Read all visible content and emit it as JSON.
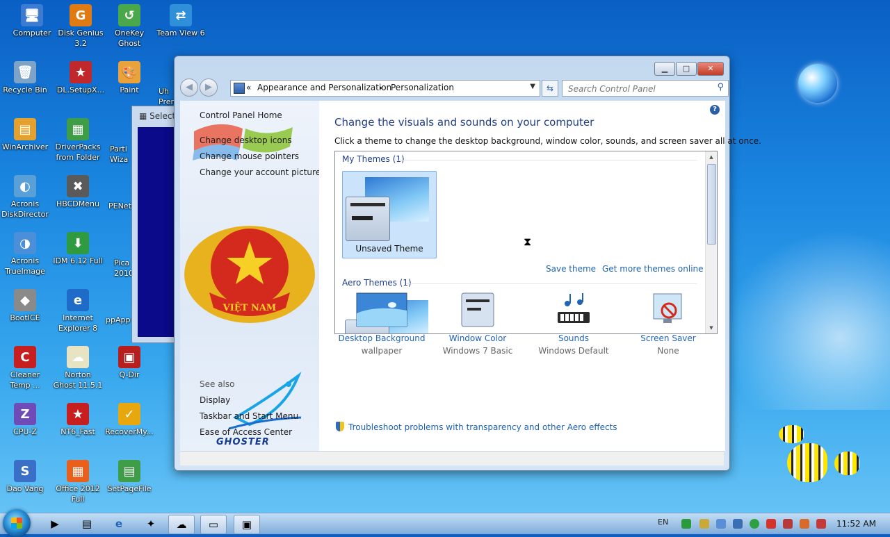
{
  "desktop": {
    "icons": [
      {
        "label": "Computer",
        "icon": "computer-icon",
        "glyph": "🖥"
      },
      {
        "label": "Disk Genius 3.2",
        "icon": "disk-genius-icon",
        "glyph": "G"
      },
      {
        "label": "OneKey Ghost",
        "icon": "onekey-ghost-icon",
        "glyph": "↺"
      },
      {
        "label": "Team View 6",
        "icon": "teamviewer-icon",
        "glyph": "⇄"
      },
      {
        "label": "Recycle Bin",
        "icon": "recycle-bin-icon",
        "glyph": "🗑"
      },
      {
        "label": "DL.SetupX...",
        "icon": "setup-icon",
        "glyph": "★"
      },
      {
        "label": "Paint",
        "icon": "paint-icon",
        "glyph": "🎨"
      },
      {
        "label": "WinArchiver",
        "icon": "winarchiver-icon",
        "glyph": "▤"
      },
      {
        "label": "DriverPacks from Folder",
        "icon": "driverpacks-icon",
        "glyph": "▦"
      },
      {
        "label": "Acronis DiskDirector",
        "icon": "acronis-diskdirector-icon",
        "glyph": "◐"
      },
      {
        "label": "HBCDMenu",
        "icon": "hbcdmenu-icon",
        "glyph": "✖"
      },
      {
        "label": "Acronis TrueImage",
        "icon": "acronis-trueimage-icon",
        "glyph": "◑"
      },
      {
        "label": "IDM 6.12 Full",
        "icon": "idm-icon",
        "glyph": "⬇"
      },
      {
        "label": "BootICE",
        "icon": "bootice-icon",
        "glyph": "◆"
      },
      {
        "label": "Internet Explorer 8",
        "icon": "internet-explorer-icon",
        "glyph": "e"
      },
      {
        "label": "Cleaner Temp ...",
        "icon": "cleaner-icon",
        "glyph": "C"
      },
      {
        "label": "Norton Ghost 11.5.1",
        "icon": "norton-ghost-icon",
        "glyph": "☁"
      },
      {
        "label": "Q-Dir",
        "icon": "qdir-icon",
        "glyph": "▣"
      },
      {
        "label": "CPU-Z",
        "icon": "cpuz-icon",
        "glyph": "Z"
      },
      {
        "label": "NT6_Fast",
        "icon": "nt6-fast-icon",
        "glyph": "★"
      },
      {
        "label": "RecoverMy...",
        "icon": "recovermy-icon",
        "glyph": "✓"
      },
      {
        "label": "Dao Vang",
        "icon": "dao-vang-icon",
        "glyph": "S"
      },
      {
        "label": "Office 2012 Full",
        "icon": "office-icon",
        "glyph": "▦"
      },
      {
        "label": "SetPageFile",
        "icon": "setpagefile-icon",
        "glyph": "▤"
      }
    ],
    "partial_labels": {
      "uh": "Uh",
      "prem": "Prem",
      "parti": "Parti",
      "wiza": "Wiza",
      "penet": "PENet",
      "pica": "Pica",
      "y2010": "2010",
      "ppapp": "ppApp"
    }
  },
  "bg_window": {
    "title": "Select"
  },
  "window": {
    "address": {
      "chevrons": "«",
      "segment1": "Appearance and Personalization",
      "arrow": "▸",
      "segment2": "Personalization"
    },
    "search_placeholder": "Search Control Panel",
    "left_links": {
      "home": "Control Panel Home",
      "desktop_icons": "Change desktop icons",
      "mouse_pointers": "Change mouse pointers",
      "account_picture": "Change your account picture",
      "see_also": "See also",
      "display": "Display",
      "taskbar": "Taskbar and Start Menu",
      "ease": "Ease of Access Center",
      "ghoster": "GHOSTER",
      "emblem_text": "VIỆT NAM"
    },
    "content": {
      "heading": "Change the visuals and sounds on your computer",
      "subheading": "Click a theme to change the desktop background, window color, sounds, and screen saver all at once.",
      "my_themes": "My Themes (1)",
      "unsaved_theme": "Unsaved Theme",
      "save_theme": "Save theme",
      "get_more": "Get more themes online",
      "aero_themes": "Aero Themes (1)",
      "options": [
        {
          "title": "Desktop Background",
          "value": "wallpaper"
        },
        {
          "title": "Window Color",
          "value": "Windows 7 Basic"
        },
        {
          "title": "Sounds",
          "value": "Windows Default"
        },
        {
          "title": "Screen Saver",
          "value": "None"
        }
      ],
      "troubleshoot": "Troubleshoot problems with transparency and other Aero effects"
    },
    "caption": {
      "min": "▁",
      "max": "□",
      "close": "✕"
    }
  },
  "taskbar": {
    "language": "EN",
    "clock": "11:52 AM"
  },
  "colors": {
    "link": "#1f63b4",
    "heading": "#1e3d8a",
    "taskbar": "#a9c4e6"
  }
}
